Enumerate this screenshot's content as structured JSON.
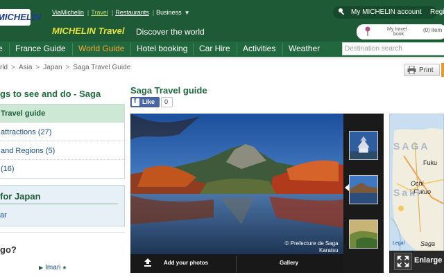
{
  "header": {
    "logo": "MICHELIN",
    "top_links": [
      "ViaMichelin",
      "Travel",
      "Restaurants",
      "Business"
    ],
    "brand_title": "MICHELIN Travel",
    "brand_tagline": "Discover the world",
    "account_label": "My MICHELIN account",
    "register_label": "Regi",
    "my_travel_book": "My travel",
    "my_travel_book_2": "book",
    "my_travel_count": "(0) item"
  },
  "nav": {
    "items": [
      "e",
      "France Guide",
      "World Guide",
      "Hotel booking",
      "Car Hire",
      "Activities",
      "Weather"
    ],
    "active": "World Guide",
    "search_placeholder": "Destination search"
  },
  "breadcrumb": [
    "rld",
    "Asia",
    "Japan",
    "Saga Travel Guide"
  ],
  "print_label": "Print",
  "sidebar": {
    "title": "gs to see and do - Saga",
    "items": [
      {
        "label": "Travel guide",
        "active": true
      },
      {
        "label": "attractions (27)",
        "active": false
      },
      {
        "label": "and Regions (5)",
        "active": false
      },
      {
        "label": "(16)",
        "active": false
      }
    ],
    "japan_title": "for Japan",
    "japan_link": "ar",
    "question": "go?",
    "nearby_link": "Imari"
  },
  "main": {
    "title": "Saga Travel guide",
    "like_label": "Like",
    "like_count": "0",
    "credit_line1": "© Prefecture de Saga",
    "credit_line2": "Karatsu",
    "add_photos": "Add your photos",
    "gallery": "Gallery"
  },
  "map": {
    "labels": [
      "SAGA",
      "Fuku",
      "Ochi",
      "Fukuo",
      "Saki",
      "Legal",
      "Saga"
    ],
    "enlarge_label": "Enlarge m"
  },
  "colors": {
    "header_green": "#1e5a36",
    "nav_green": "#22683e",
    "active_orange": "#f1a93a",
    "link_blue": "#1a4f8a"
  }
}
